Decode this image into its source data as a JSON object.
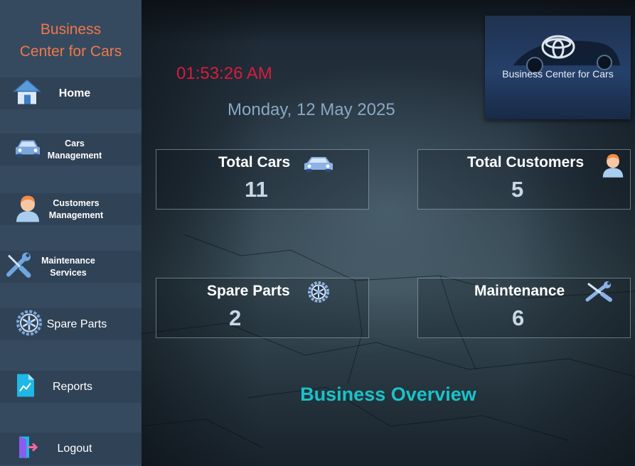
{
  "sidebar": {
    "brand_line1": "Business",
    "brand_line2": "Center for Cars",
    "items": [
      {
        "label": "Home",
        "icon": "house-icon"
      },
      {
        "label": "Cars\nManagement",
        "icon": "car-icon"
      },
      {
        "label": "Customers\nManagement",
        "icon": "customer-avatar-icon"
      },
      {
        "label": "Maintenance\nServices",
        "icon": "wrench-screwdriver-icon"
      },
      {
        "label": "Spare Parts",
        "icon": "gear-wheel-icon"
      },
      {
        "label": "Reports",
        "icon": "report-document-icon"
      },
      {
        "label": "Logout",
        "icon": "logout-door-icon"
      }
    ]
  },
  "header": {
    "time": "01:53:26 AM",
    "date": "Monday, 12 May 2025",
    "logo_text": "Business Center for Cars"
  },
  "cards": {
    "total_cars": {
      "title": "Total Cars",
      "value": "11",
      "icon": "car-icon"
    },
    "total_customers": {
      "title": "Total Customers",
      "value": "5",
      "icon": "customer-avatar-icon"
    },
    "spare_parts": {
      "title": "Spare Parts",
      "value": "2",
      "icon": "gear-wheel-icon"
    },
    "maintenance": {
      "title": "Maintenance",
      "value": "6",
      "icon": "wrench-screwdriver-icon"
    }
  },
  "overview_title": "Business Overview",
  "colors": {
    "sidebar_bg": "#354a5f",
    "nav_item_bg": "#2f4256",
    "brand": "#f0784a",
    "clock": "#d91c3c",
    "date": "#8aa8c4",
    "overview": "#19c3c8"
  }
}
